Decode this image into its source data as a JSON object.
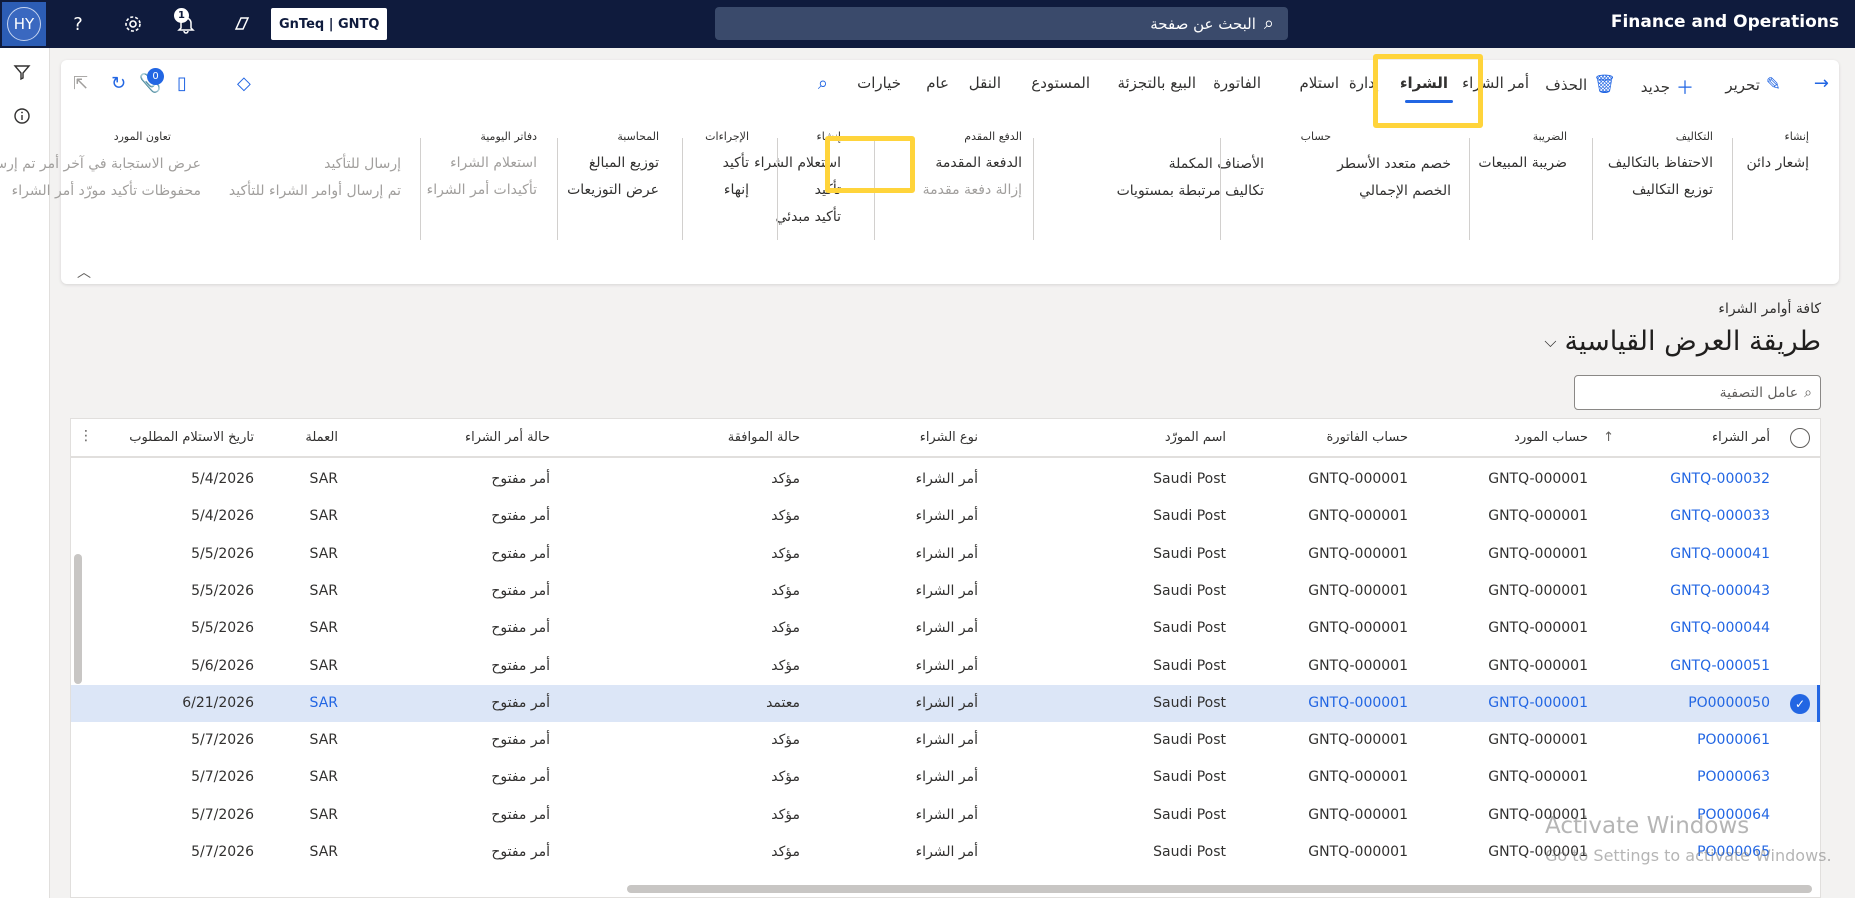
{
  "topbar": {
    "avatar": "HY",
    "company": "GnTeq | GNTQ",
    "notification_count": "1",
    "search_placeholder": "البحث عن صفحة",
    "app_title": "Finance and Operations"
  },
  "actionbar": {
    "back": "",
    "edit": "تحرير",
    "new": "جديد",
    "delete": "الحذف",
    "tabs": [
      "أمر الشراء",
      "الشراء",
      "إدارة",
      "استلام",
      "الفاتورة",
      "البيع بالتجزئة",
      "المستودع",
      "النقل",
      "عام",
      "خيارات"
    ],
    "active_tab": "الشراء",
    "attachments_count": "0"
  },
  "groups": [
    {
      "title": "إنشاء",
      "items": [
        {
          "label": "إشعار دائن",
          "disabled": false
        }
      ]
    },
    {
      "title": "التكاليف",
      "items": [
        {
          "label": "الاحتفاظ بالتكاليف",
          "disabled": false
        },
        {
          "label": "توزيع التكاليف",
          "disabled": false
        }
      ]
    },
    {
      "title": "الضريبة",
      "items": [
        {
          "label": "ضريبة المبيعات",
          "disabled": false
        }
      ]
    },
    {
      "title": "حساب",
      "items": [
        {
          "label": "خصم متعدد الأسطر",
          "disabled": false
        },
        {
          "label": "الخصم الإجمالي",
          "disabled": false
        },
        {
          "label": "الأصناف المكملة",
          "disabled": false
        },
        {
          "label": "تكاليف مرتبطة بمستويات",
          "disabled": false
        }
      ]
    },
    {
      "title": "الدفع المقدم",
      "items": [
        {
          "label": "الدفعة المقدمة",
          "disabled": false
        },
        {
          "label": "إزالة دفعة مقدمة",
          "disabled": true
        }
      ]
    },
    {
      "title": "إنشاء",
      "items": [
        {
          "label": "استعلام الشراء",
          "disabled": false
        },
        {
          "label": "تأكيد",
          "disabled": false
        },
        {
          "label": "تأكيد مبدئي",
          "disabled": false
        }
      ]
    },
    {
      "title": "الإجراءات",
      "items": [
        {
          "label": "تأكيد",
          "disabled": false
        },
        {
          "label": "إنهاء",
          "disabled": false
        }
      ]
    },
    {
      "title": "المحاسبة",
      "items": [
        {
          "label": "توزيع المبالغ",
          "disabled": false
        },
        {
          "label": "عرض التوزيعات",
          "disabled": false
        }
      ]
    },
    {
      "title": "دفاتر اليومية",
      "items": [
        {
          "label": "استعلام الشراء",
          "disabled": true
        },
        {
          "label": "تأكيدات أمر الشراء",
          "disabled": true
        }
      ]
    },
    {
      "title": "تعاون المورد",
      "items": [
        {
          "label": "إرسال للتأكيد",
          "disabled": true
        },
        {
          "label": "تم إرسال أوامر الشراء للتأكيد",
          "disabled": true
        },
        {
          "label": "عرض الاستجابة في آخر أمر تم إرساله",
          "disabled": true
        },
        {
          "label": "محفوظات تأكيد مورّد أمر الشراء",
          "disabled": true
        }
      ]
    }
  ],
  "page": {
    "breadcrumb": "كافة أوامر الشراء",
    "view_title": "طريقة العرض القياسية",
    "filter_placeholder": "عامل التصفية"
  },
  "grid": {
    "columns": [
      "أمر الشراء",
      "حساب المورد",
      "حساب الفاتورة",
      "اسم المورّد",
      "نوع الشراء",
      "حالة الموافقة",
      "حالة أمر الشراء",
      "العملة",
      "تاريخ الاستلام المطلوب"
    ],
    "rows": [
      {
        "po": "GNTQ-000032",
        "vendor": "GNTQ-000001",
        "invoice": "GNTQ-000001",
        "name": "Saudi Post",
        "type": "أمر الشراء",
        "approval": "مؤكد",
        "status": "أمر مفتوح",
        "currency": "SAR",
        "date": "5/4/2026",
        "selected": false
      },
      {
        "po": "GNTQ-000033",
        "vendor": "GNTQ-000001",
        "invoice": "GNTQ-000001",
        "name": "Saudi Post",
        "type": "أمر الشراء",
        "approval": "مؤكد",
        "status": "أمر مفتوح",
        "currency": "SAR",
        "date": "5/4/2026",
        "selected": false
      },
      {
        "po": "GNTQ-000041",
        "vendor": "GNTQ-000001",
        "invoice": "GNTQ-000001",
        "name": "Saudi Post",
        "type": "أمر الشراء",
        "approval": "مؤكد",
        "status": "أمر مفتوح",
        "currency": "SAR",
        "date": "5/5/2026",
        "selected": false
      },
      {
        "po": "GNTQ-000043",
        "vendor": "GNTQ-000001",
        "invoice": "GNTQ-000001",
        "name": "Saudi Post",
        "type": "أمر الشراء",
        "approval": "مؤكد",
        "status": "أمر مفتوح",
        "currency": "SAR",
        "date": "5/5/2026",
        "selected": false
      },
      {
        "po": "GNTQ-000044",
        "vendor": "GNTQ-000001",
        "invoice": "GNTQ-000001",
        "name": "Saudi Post",
        "type": "أمر الشراء",
        "approval": "مؤكد",
        "status": "أمر مفتوح",
        "currency": "SAR",
        "date": "5/5/2026",
        "selected": false
      },
      {
        "po": "GNTQ-000051",
        "vendor": "GNTQ-000001",
        "invoice": "GNTQ-000001",
        "name": "Saudi Post",
        "type": "أمر الشراء",
        "approval": "مؤكد",
        "status": "أمر مفتوح",
        "currency": "SAR",
        "date": "5/6/2026",
        "selected": false
      },
      {
        "po": "PO0000050",
        "vendor": "GNTQ-000001",
        "invoice": "GNTQ-000001",
        "name": "Saudi Post",
        "type": "أمر الشراء",
        "approval": "معتمد",
        "status": "أمر مفتوح",
        "currency": "SAR",
        "date": "6/21/2026",
        "selected": true
      },
      {
        "po": "PO000061",
        "vendor": "GNTQ-000001",
        "invoice": "GNTQ-000001",
        "name": "Saudi Post",
        "type": "أمر الشراء",
        "approval": "مؤكد",
        "status": "أمر مفتوح",
        "currency": "SAR",
        "date": "5/7/2026",
        "selected": false
      },
      {
        "po": "PO000063",
        "vendor": "GNTQ-000001",
        "invoice": "GNTQ-000001",
        "name": "Saudi Post",
        "type": "أمر الشراء",
        "approval": "مؤكد",
        "status": "أمر مفتوح",
        "currency": "SAR",
        "date": "5/7/2026",
        "selected": false
      },
      {
        "po": "PO000064",
        "vendor": "GNTQ-000001",
        "invoice": "GNTQ-000001",
        "name": "Saudi Post",
        "type": "أمر الشراء",
        "approval": "مؤكد",
        "status": "أمر مفتوح",
        "currency": "SAR",
        "date": "5/7/2026",
        "selected": false
      },
      {
        "po": "PO000065",
        "vendor": "GNTQ-000001",
        "invoice": "GNTQ-000001",
        "name": "Saudi Post",
        "type": "أمر الشراء",
        "approval": "مؤكد",
        "status": "أمر مفتوح",
        "currency": "SAR",
        "date": "5/7/2026",
        "selected": false
      }
    ]
  },
  "watermark": {
    "line1": "Activate Windows",
    "line2": "Go to Settings to activate Windows."
  },
  "icons": {
    "search": "search-icon",
    "settings": "gear-icon",
    "help": "help-icon",
    "notifications": "bell-icon",
    "copilot": "copilot-icon",
    "filter": "filter-icon",
    "info": "info-icon"
  },
  "colors": {
    "topbar": "#0f1b3d",
    "accent": "#2266e3",
    "highlight": "#ffd43b",
    "selected_row": "#dce6f7"
  }
}
